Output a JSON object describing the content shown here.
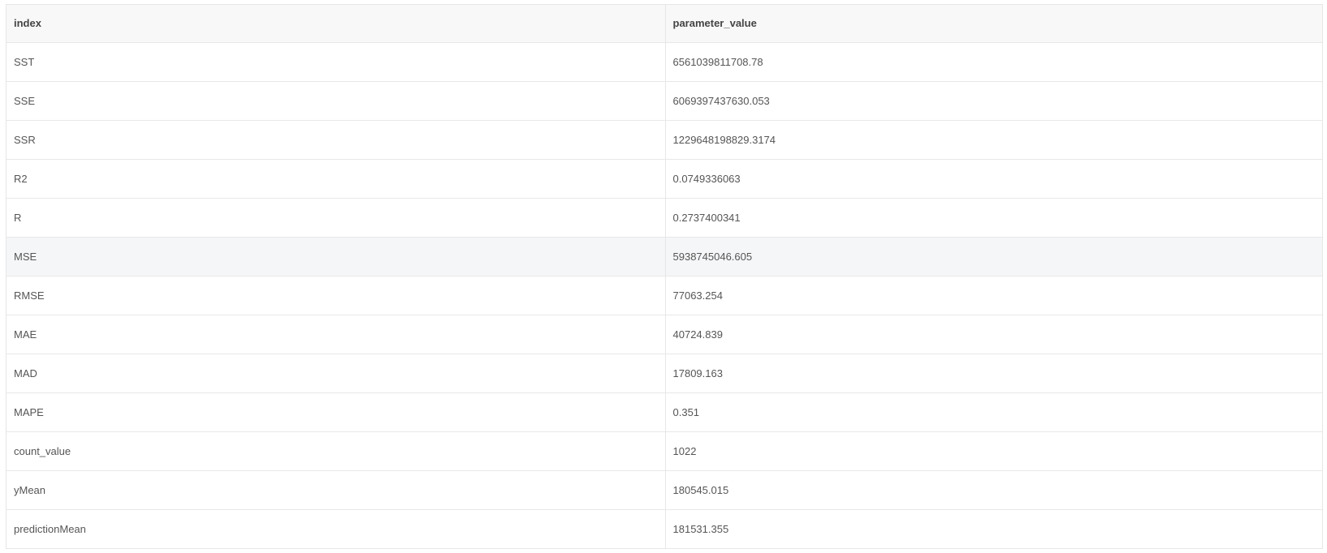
{
  "table": {
    "headers": [
      "index",
      "parameter_value"
    ],
    "rows": [
      {
        "index": "SST",
        "value": "6561039811708.78"
      },
      {
        "index": "SSE",
        "value": "6069397437630.053"
      },
      {
        "index": "SSR",
        "value": "1229648198829.3174"
      },
      {
        "index": "R2",
        "value": "0.0749336063"
      },
      {
        "index": "R",
        "value": "0.2737400341"
      },
      {
        "index": "MSE",
        "value": "5938745046.605"
      },
      {
        "index": "RMSE",
        "value": "77063.254"
      },
      {
        "index": "MAE",
        "value": "40724.839"
      },
      {
        "index": "MAD",
        "value": "17809.163"
      },
      {
        "index": "MAPE",
        "value": "0.351"
      },
      {
        "index": "count_value",
        "value": "1022"
      },
      {
        "index": "yMean",
        "value": "180545.015"
      },
      {
        "index": "predictionMean",
        "value": "181531.355"
      }
    ],
    "hovered_row": 5
  }
}
